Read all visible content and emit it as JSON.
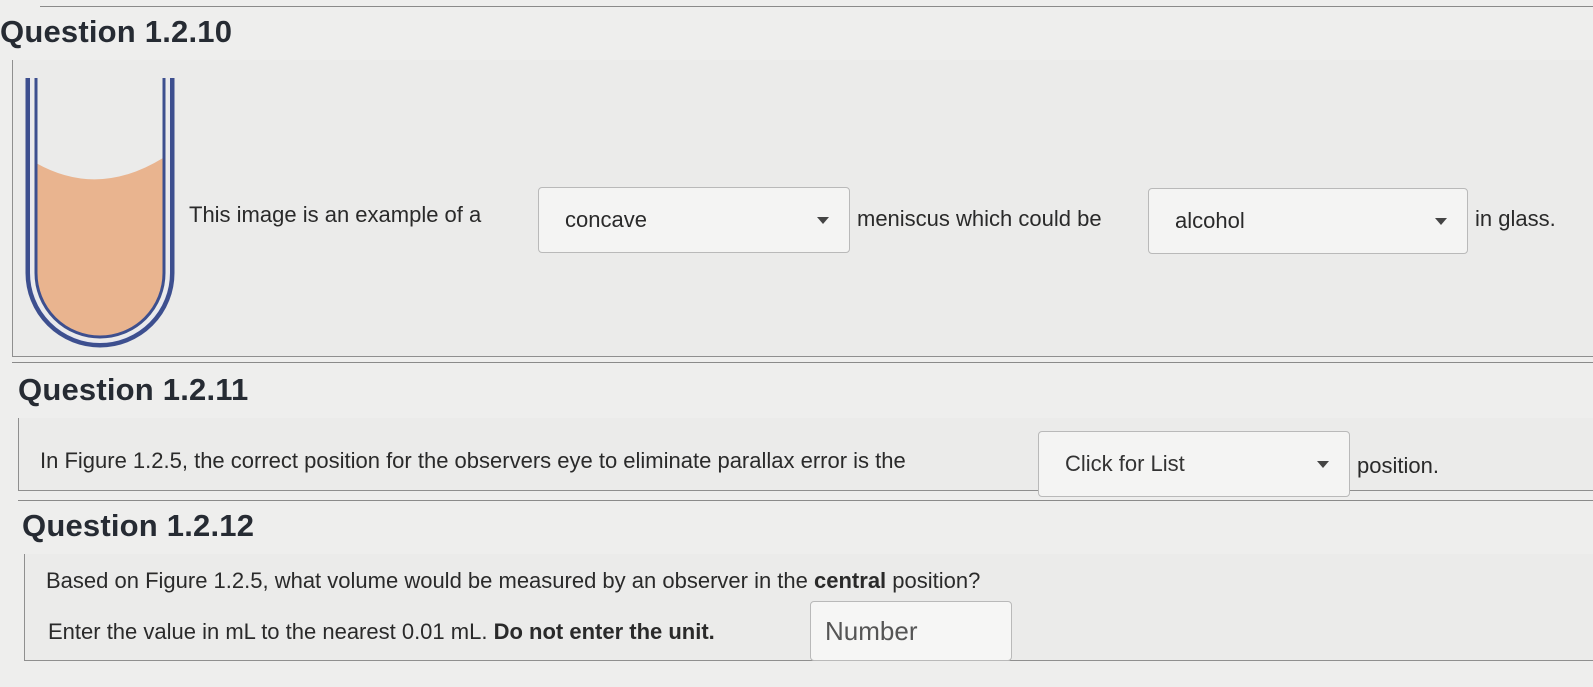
{
  "q10": {
    "title": "Question 1.2.10",
    "sentence_start": "This image is an example of a",
    "select1_value": "concave",
    "sentence_mid": "meniscus which could be",
    "select2_value": "alcohol",
    "sentence_end": "in glass."
  },
  "q11": {
    "title": "Question 1.2.11",
    "sentence_start": "In Figure 1.2.5, the correct position for the observers eye to eliminate parallax error is the",
    "select_value": "Click for List",
    "sentence_end": "position."
  },
  "q12": {
    "title": "Question 1.2.12",
    "question_start": "Based on Figure 1.2.5, what volume would be measured by an observer in the",
    "question_bold": "central",
    "question_end": "position?",
    "instruction": "Enter the value in mL to the nearest 0.01 mL.",
    "instruction_bold": "Do not enter the unit.",
    "input_placeholder": "Number"
  },
  "colors": {
    "tube_outline": "#3d4f8f",
    "liquid": "#e9b48f"
  },
  "icons": {
    "dropdown": "caret-down-icon"
  }
}
